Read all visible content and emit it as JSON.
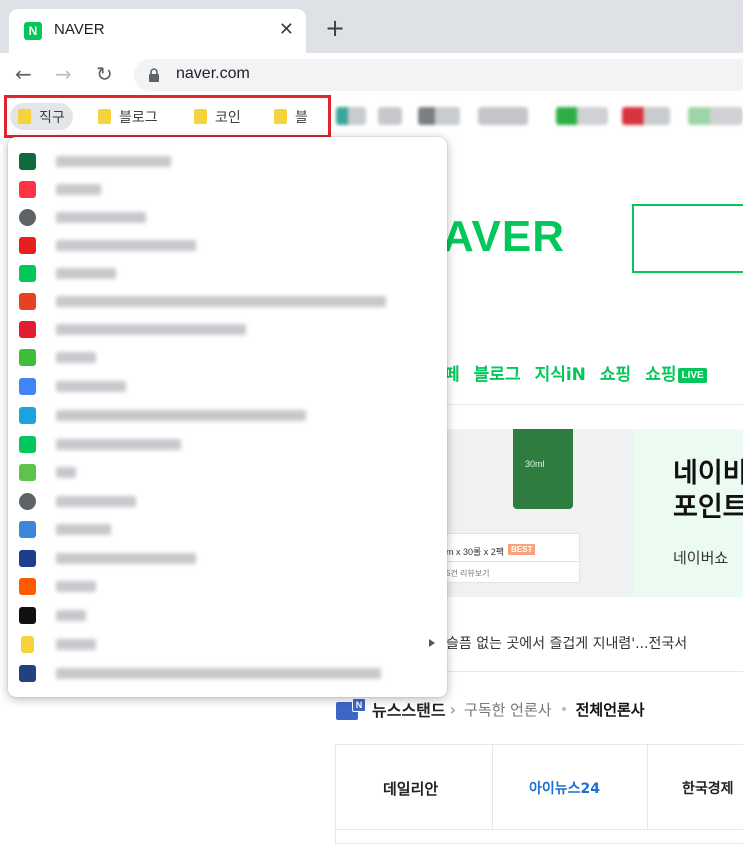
{
  "browser": {
    "tab": {
      "title": "NAVER",
      "favicon_text": "N",
      "close": "✕"
    },
    "new_tab": "+",
    "nav": {
      "back": "←",
      "forward": "→",
      "reload": "↻"
    },
    "url": "naver.com"
  },
  "bookmarks_bar": {
    "items": [
      {
        "label": "직구",
        "icon": "folder-icon"
      },
      {
        "label": "블로그",
        "icon": "folder-icon"
      },
      {
        "label": "코인",
        "icon": "folder-icon"
      },
      {
        "label": "블",
        "icon": "folder-icon"
      }
    ]
  },
  "dropdown": {
    "items": [
      {
        "icon": "green-badge-icon",
        "color": "#0f6b3b"
      },
      {
        "icon": "11st-icon",
        "color": "#ff3344"
      },
      {
        "icon": "globe-icon",
        "color": "#5f6368"
      },
      {
        "icon": "a-icon",
        "color": "#e8201b"
      },
      {
        "icon": "naver-icon",
        "color": "#03c75a"
      },
      {
        "icon": "aliexpress-icon",
        "color": "#e8411d"
      },
      {
        "icon": "red-hexagon-icon",
        "color": "#e01e2f"
      },
      {
        "icon": "green-leaf-icon",
        "color": "#3ebd3a"
      },
      {
        "icon": "google-translate-icon",
        "color": "#4285f4"
      },
      {
        "icon": "edge-icon",
        "color": "#1aa4de"
      },
      {
        "icon": "naver-icon",
        "color": "#03c75a"
      },
      {
        "icon": "green-shield-icon",
        "color": "#5fc24d"
      },
      {
        "icon": "globe-icon",
        "color": "#5f6368"
      },
      {
        "icon": "pin-icon",
        "color": "#3a88d8"
      },
      {
        "icon": "17-icon",
        "color": "#1e3d8f"
      },
      {
        "icon": "taobao-icon",
        "color": "#ff5a00"
      },
      {
        "icon": "dsw-icon",
        "color": "#111111"
      },
      {
        "icon": "folder-icon",
        "color": "#f6d23d",
        "submenu": true
      },
      {
        "icon": "shield-crest-icon",
        "color": "#23407f"
      }
    ]
  },
  "page": {
    "logo": "AVER",
    "menu": [
      "페",
      "블로그",
      "지식iN",
      "쇼핑",
      "쇼핑"
    ],
    "live_badge": "LIVE",
    "banner": {
      "title_line1": "네이비",
      "title_line2": "포인트",
      "subtitle": "네이버쇼",
      "product_label": "30ml",
      "card_text": "m x 30롤 x 2팩",
      "best_tag": "BEST",
      "card_sub": "5건 리뷰보기"
    },
    "news": "슬픔 없는 곳에서 즐겁게 지내렴'...전국서",
    "newsstand": {
      "title": "뉴스스탠드",
      "chevron": "›",
      "subscribed": "구독한 언론사",
      "all": "전체언론사",
      "icon_letter": "N"
    },
    "press": [
      "데일리안",
      "아이뉴스24",
      "한국경제"
    ]
  },
  "colors": {
    "naver_green": "#03c75a",
    "highlight_red": "#e0262b"
  }
}
